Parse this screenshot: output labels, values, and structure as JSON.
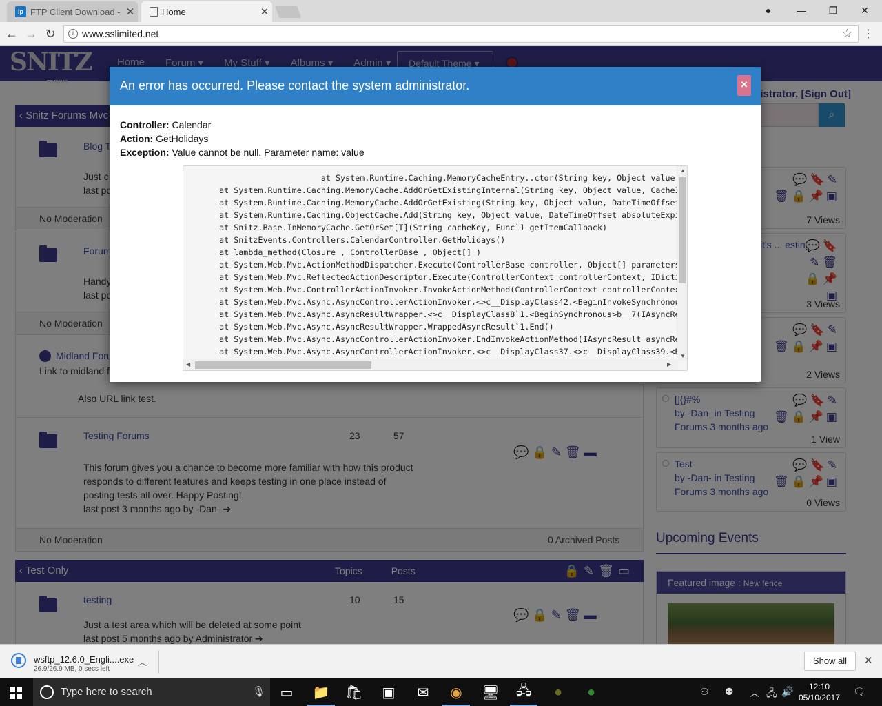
{
  "browser": {
    "tabs": [
      {
        "title": "FTP Client Download - W",
        "favicon": "ip",
        "active": false
      },
      {
        "title": "Home",
        "active": true
      }
    ],
    "url": "www.sslimited.net"
  },
  "site": {
    "logo": "SNITZ",
    "logo_sub": "FORUMS",
    "nav": [
      "Home",
      "Forum ▾",
      "My Stuff ▾",
      "Albums ▾",
      "Admin ▾"
    ],
    "theme_button": "Default Theme",
    "user_line": "inistrator, [Sign Out]"
  },
  "left": {
    "category1": {
      "title": "Snitz Forums Mvc"
    },
    "forums": [
      {
        "name": "Blog T",
        "line1": "Just c",
        "line2": "last po",
        "moderation": "No Moderation"
      },
      {
        "name": "Forum",
        "line1": "Handy",
        "line2": "last po",
        "moderation": "No Moderation"
      },
      {
        "name": "Midland Foru",
        "line1": "Link to midland f",
        "line2": "Also URL link test."
      },
      {
        "name": "Testing Forums",
        "topics": "23",
        "posts": "57",
        "desc1": "This forum gives you a chance to become more familiar with how this product",
        "desc2": "responds to different features and keeps testing in one place instead of",
        "desc3": "posting tests all over. Happy Posting!",
        "lastpost": "last post  3 months ago  by  -Dan- ➔",
        "moderation": "No Moderation",
        "archived": "0 Archived Posts"
      }
    ],
    "category2": {
      "title": "Test Only",
      "col_topics": "Topics",
      "col_posts": "Posts"
    },
    "testing": {
      "name": "testing",
      "topics": "10",
      "posts": "15",
      "desc": "Just a test area which will be deleted at some point",
      "lastpost": "last post  5 months ago  by  Administrator ➔"
    }
  },
  "right": {
    "topics": [
      {
        "title": "",
        "views": "7 Views"
      },
      {
        "title": "it's ...  esting",
        "views": "3 Views"
      },
      {
        "title": "",
        "views": "2 Views"
      },
      {
        "title": "[]{}#%",
        "by": "by -Dan- in Testing Forums  3 months ago",
        "views": "1 View"
      },
      {
        "title": "Test",
        "by": "by -Dan- in Testing Forums  3 months ago",
        "views": "0 Views"
      }
    ],
    "upcoming": "Upcoming Events",
    "featured": "Featured image : ",
    "featured_name": "New fence"
  },
  "modal": {
    "title": "An error has occurred. Please contact the system administrator.",
    "close": "×",
    "controller_label": "Controller:",
    "controller": "Calendar",
    "action_label": "Action:",
    "action": "GetHolidays",
    "exception_label": "Exception:",
    "exception": "Value cannot be null. Parameter name: value",
    "stack": "                        at System.Runtime.Caching.MemoryCacheEntry..ctor(String key, Object value\n   at System.Runtime.Caching.MemoryCache.AddOrGetExistingInternal(String key, Object value, CacheIte\n   at System.Runtime.Caching.MemoryCache.AddOrGetExisting(String key, Object value, DateTimeOffset a\n   at System.Runtime.Caching.ObjectCache.Add(String key, Object value, DateTimeOffset absoluteExpira\n   at Snitz.Base.InMemoryCache.GetOrSet[T](String cacheKey, Func`1 getItemCallback)\n   at SnitzEvents.Controllers.CalendarController.GetHolidays()\n   at lambda_method(Closure , ControllerBase , Object[] )\n   at System.Web.Mvc.ActionMethodDispatcher.Execute(ControllerBase controller, Object[] parameters)\n   at System.Web.Mvc.ReflectedActionDescriptor.Execute(ControllerContext controllerContext, IDictio\n   at System.Web.Mvc.ControllerActionInvoker.InvokeActionMethod(ControllerContext controllerContext\n   at System.Web.Mvc.Async.AsyncControllerActionInvoker.<>c__DisplayClass42.<BeginInvokeSynchronous\n   at System.Web.Mvc.Async.AsyncResultWrapper.<>c__DisplayClass8`1.<BeginSynchronous>b__7(IAsyncRes\n   at System.Web.Mvc.Async.AsyncResultWrapper.WrappedAsyncResult`1.End()\n   at System.Web.Mvc.Async.AsyncControllerActionInvoker.EndInvokeActionMethod(IAsyncResult asyncRes\n   at System.Web.Mvc.Async.AsyncControllerActionInvoker.<>c__DisplayClass37.<>c__DisplayClass39.<Be"
  },
  "download": {
    "filename": "wsftp_12.6.0_Engli....exe",
    "size": "26.9/26.9 MB, 0 secs left",
    "show_all": "Show all"
  },
  "taskbar": {
    "search_placeholder": "Type here to search",
    "time": "12:10",
    "date": "05/10/2017"
  }
}
